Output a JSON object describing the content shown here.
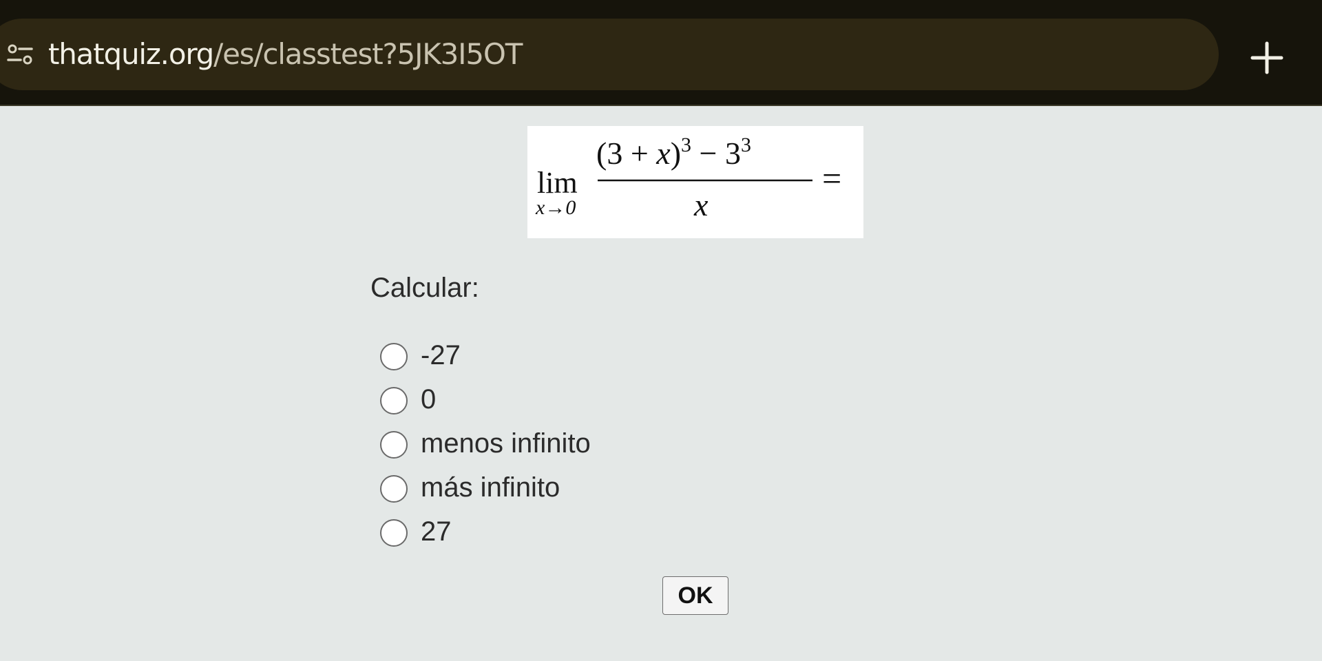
{
  "browser": {
    "url_domain": "thatquiz.org",
    "url_path": "/es/classtest?5JK3I5OT",
    "site_info_icon": "tune-icon",
    "new_tab_icon": "plus-icon"
  },
  "question": {
    "formula": {
      "lim": "lim",
      "lim_sub": "x→0",
      "numerator_open": "(3 + ",
      "numerator_var": "x",
      "numerator_close": ")",
      "exp1": "3",
      "minus_base": " − 3",
      "exp2": "3",
      "denominator": "x",
      "equals": "="
    },
    "label": "Calcular:",
    "options": [
      {
        "label": "-27"
      },
      {
        "label": "0"
      },
      {
        "label": "menos infinito"
      },
      {
        "label": "más infinito"
      },
      {
        "label": "27"
      }
    ],
    "submit_label": "OK"
  }
}
